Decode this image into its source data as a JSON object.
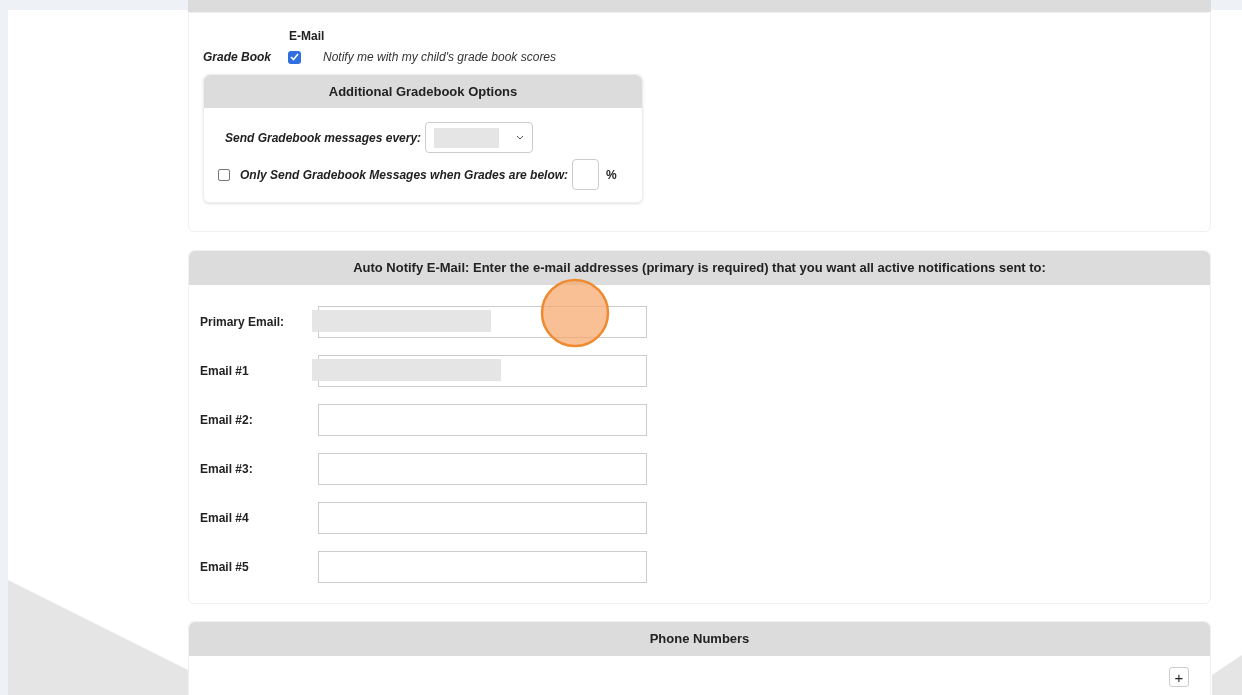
{
  "notifications": {
    "column_header": "E-Mail",
    "rows": [
      {
        "label": "Grade Book",
        "checked": true,
        "description": "Notify me with my child's grade book scores"
      }
    ]
  },
  "gradebook_options": {
    "title": "Additional Gradebook Options",
    "frequency_label": "Send Gradebook messages every:",
    "frequency_redacted": true,
    "threshold": {
      "checked": false,
      "label": "Only Send Gradebook Messages when Grades are below:",
      "unit": "%"
    }
  },
  "auto_notify": {
    "title": "Auto Notify E-Mail: Enter the e-mail addresses (primary is required) that you want all active notifications sent to:",
    "emails": [
      {
        "label": "Primary Email:",
        "redacted": true
      },
      {
        "label": "Email #1",
        "redacted": true
      },
      {
        "label": "Email #2:",
        "redacted": false
      },
      {
        "label": "Email #3:",
        "redacted": false
      },
      {
        "label": "Email #4",
        "redacted": false
      },
      {
        "label": "Email #5",
        "redacted": false
      }
    ]
  },
  "phone_numbers": {
    "title": "Phone Numbers",
    "add_button": "+"
  }
}
